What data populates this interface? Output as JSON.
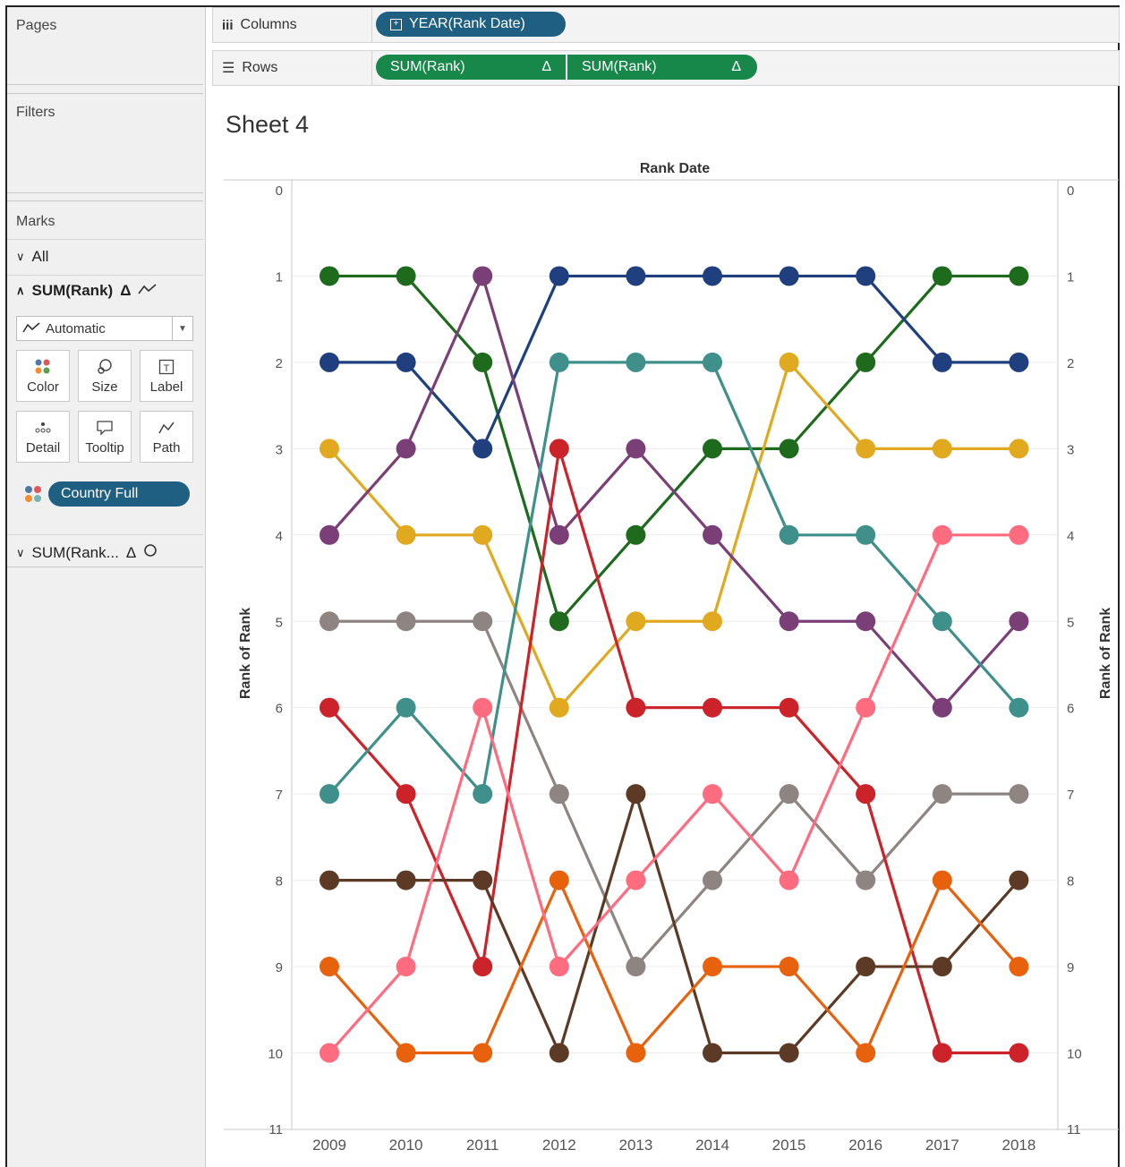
{
  "shelves": {
    "pages_label": "Pages",
    "filters_label": "Filters",
    "columns_label": "Columns",
    "rows_label": "Rows",
    "columns_pill": "YEAR(Rank Date)",
    "rows_pill_1": "SUM(Rank)",
    "rows_pill_2": "SUM(Rank)",
    "delta_symbol": "Δ"
  },
  "marks": {
    "title": "Marks",
    "all_label": "All",
    "section1_label": "SUM(Rank)",
    "mark_type": "Automatic",
    "buttons": {
      "color": "Color",
      "size": "Size",
      "label": "Label",
      "detail": "Detail",
      "tooltip": "Tooltip",
      "path": "Path"
    },
    "color_pill": "Country Full",
    "section2_label": "SUM(Rank..."
  },
  "sheet": {
    "title": "Sheet 4"
  },
  "chart_data": {
    "type": "line",
    "title": "",
    "column_header": "Rank Date",
    "xlabel": "",
    "ylabel": "Rank of Rank",
    "y2label": "Rank of Rank",
    "x": [
      "2009",
      "2010",
      "2011",
      "2012",
      "2013",
      "2014",
      "2015",
      "2016",
      "2017",
      "2018"
    ],
    "ylim": [
      0,
      11
    ],
    "y_reversed": true,
    "y_ticks": [
      "0",
      "1",
      "2",
      "3",
      "4",
      "5",
      "6",
      "7",
      "8",
      "9",
      "10",
      "11"
    ],
    "grid": true,
    "legend": "none",
    "series": [
      {
        "color": "#1e6b1e",
        "values": [
          1,
          1,
          2,
          5,
          4,
          3,
          3,
          2,
          1,
          1
        ]
      },
      {
        "color": "#1f3f7f",
        "values": [
          2,
          2,
          3,
          1,
          1,
          1,
          1,
          1,
          2,
          2
        ]
      },
      {
        "color": "#e0a91f",
        "values": [
          3,
          4,
          4,
          6,
          5,
          5,
          2,
          3,
          3,
          3
        ]
      },
      {
        "color": "#7b3f78",
        "values": [
          4,
          3,
          1,
          4,
          3,
          4,
          5,
          5,
          6,
          5
        ]
      },
      {
        "color": "#8e8482",
        "values": [
          5,
          5,
          5,
          7,
          9,
          8,
          7,
          8,
          7,
          7
        ]
      },
      {
        "color": "#cc2229",
        "values": [
          6,
          7,
          9,
          3,
          6,
          6,
          6,
          7,
          10,
          10
        ]
      },
      {
        "color": "#3f8f8a",
        "values": [
          7,
          6,
          7,
          2,
          2,
          2,
          4,
          4,
          5,
          6
        ]
      },
      {
        "color": "#5c3a26",
        "values": [
          8,
          8,
          8,
          10,
          7,
          10,
          10,
          9,
          9,
          8
        ]
      },
      {
        "color": "#e8620e",
        "values": [
          9,
          10,
          10,
          8,
          10,
          9,
          9,
          10,
          8,
          9
        ]
      },
      {
        "color": "#ff6b7f",
        "values": [
          10,
          9,
          6,
          9,
          8,
          7,
          8,
          6,
          4,
          4
        ]
      }
    ]
  }
}
